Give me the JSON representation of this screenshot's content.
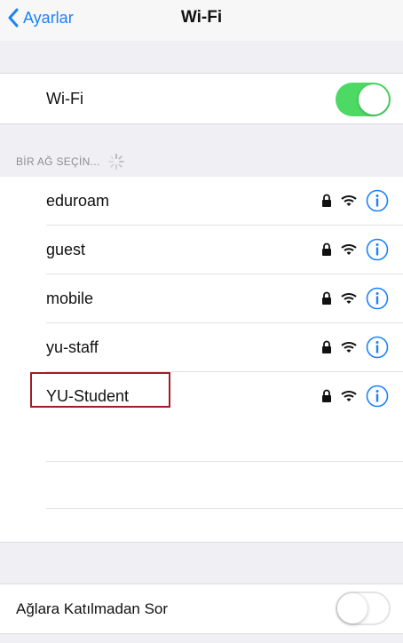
{
  "navbar": {
    "back_label": "Ayarlar",
    "title": "Wi-Fi"
  },
  "wifi": {
    "label": "Wi-Fi",
    "enabled": true
  },
  "networks_section": {
    "header": "BİR AĞ SEÇİN..."
  },
  "networks": [
    {
      "name": "eduroam"
    },
    {
      "name": "guest"
    },
    {
      "name": "mobile"
    },
    {
      "name": "yu-staff"
    },
    {
      "name": "YU-Student",
      "highlighted": true
    }
  ],
  "ask_to_join": {
    "label": "Ağlara Katılmadan Sor",
    "enabled": false
  },
  "colors": {
    "accent": "#1a82fb",
    "toggle_on": "#4cd964",
    "highlight_box": "#a31b23"
  }
}
